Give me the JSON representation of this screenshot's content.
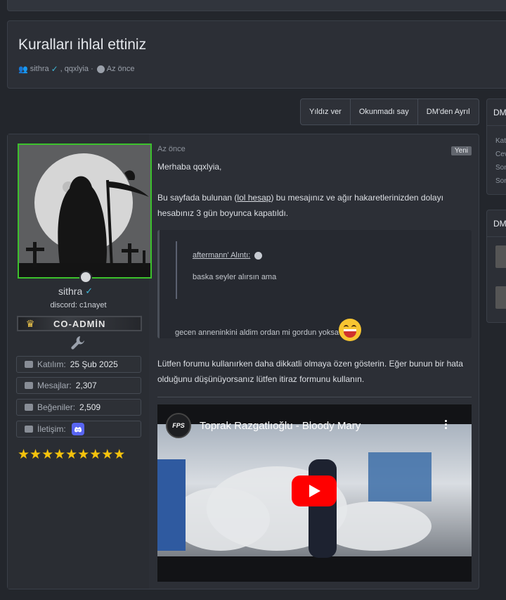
{
  "thread": {
    "title": "Kuralları ihlal ettiniz",
    "participants": "sithra",
    "participants_rest": ", qqxlyia ·",
    "time": "Az önce"
  },
  "actions": [
    "Yıldız ver",
    "Okunmadı say",
    "DM'den Ayrıl"
  ],
  "sidebar": {
    "widget1_title": "DM",
    "widget1_lines": [
      "Kat",
      "Cev",
      "Son",
      "Son"
    ],
    "widget2_title": "DM"
  },
  "user": {
    "name": "sithra",
    "discord": "discord: c1nayet",
    "rank": "CO-ADMİN",
    "stats": [
      {
        "key": "Katılım:",
        "value": "25 Şub 2025"
      },
      {
        "key": "Mesajlar:",
        "value": "2,307"
      },
      {
        "key": "Beğeniler:",
        "value": "2,509"
      },
      {
        "key": "İletişim:",
        "value": ""
      }
    ],
    "stars": "★★★★★★★★★"
  },
  "message": {
    "time": "Az önce",
    "badge": "Yeni",
    "greeting": "Merhaba qqxlyia,",
    "body_before": "Bu sayfada bulunan (",
    "link": "lol hesap",
    "body_after": ") bu mesajınız ve ağır hakaretlerinizden dolayı hesabınız 3 gün boyunca kapatıldı.",
    "quote": {
      "author": "aftermann' Alıntı:",
      "text": "baska seyler alırsın ama",
      "reply": "gecen anneninkini aldim ordan mi gordun yoksa"
    },
    "closing": "Lütfen forumu kullanırken daha dikkatli olmaya özen gösterin. Eğer bunun bir hata olduğunu düşünüyorsanız lütfen itiraz formunu kullanın."
  },
  "video": {
    "title": "Toprak Razgatlıoğlu - Bloody Mary",
    "channel": "FPS"
  }
}
